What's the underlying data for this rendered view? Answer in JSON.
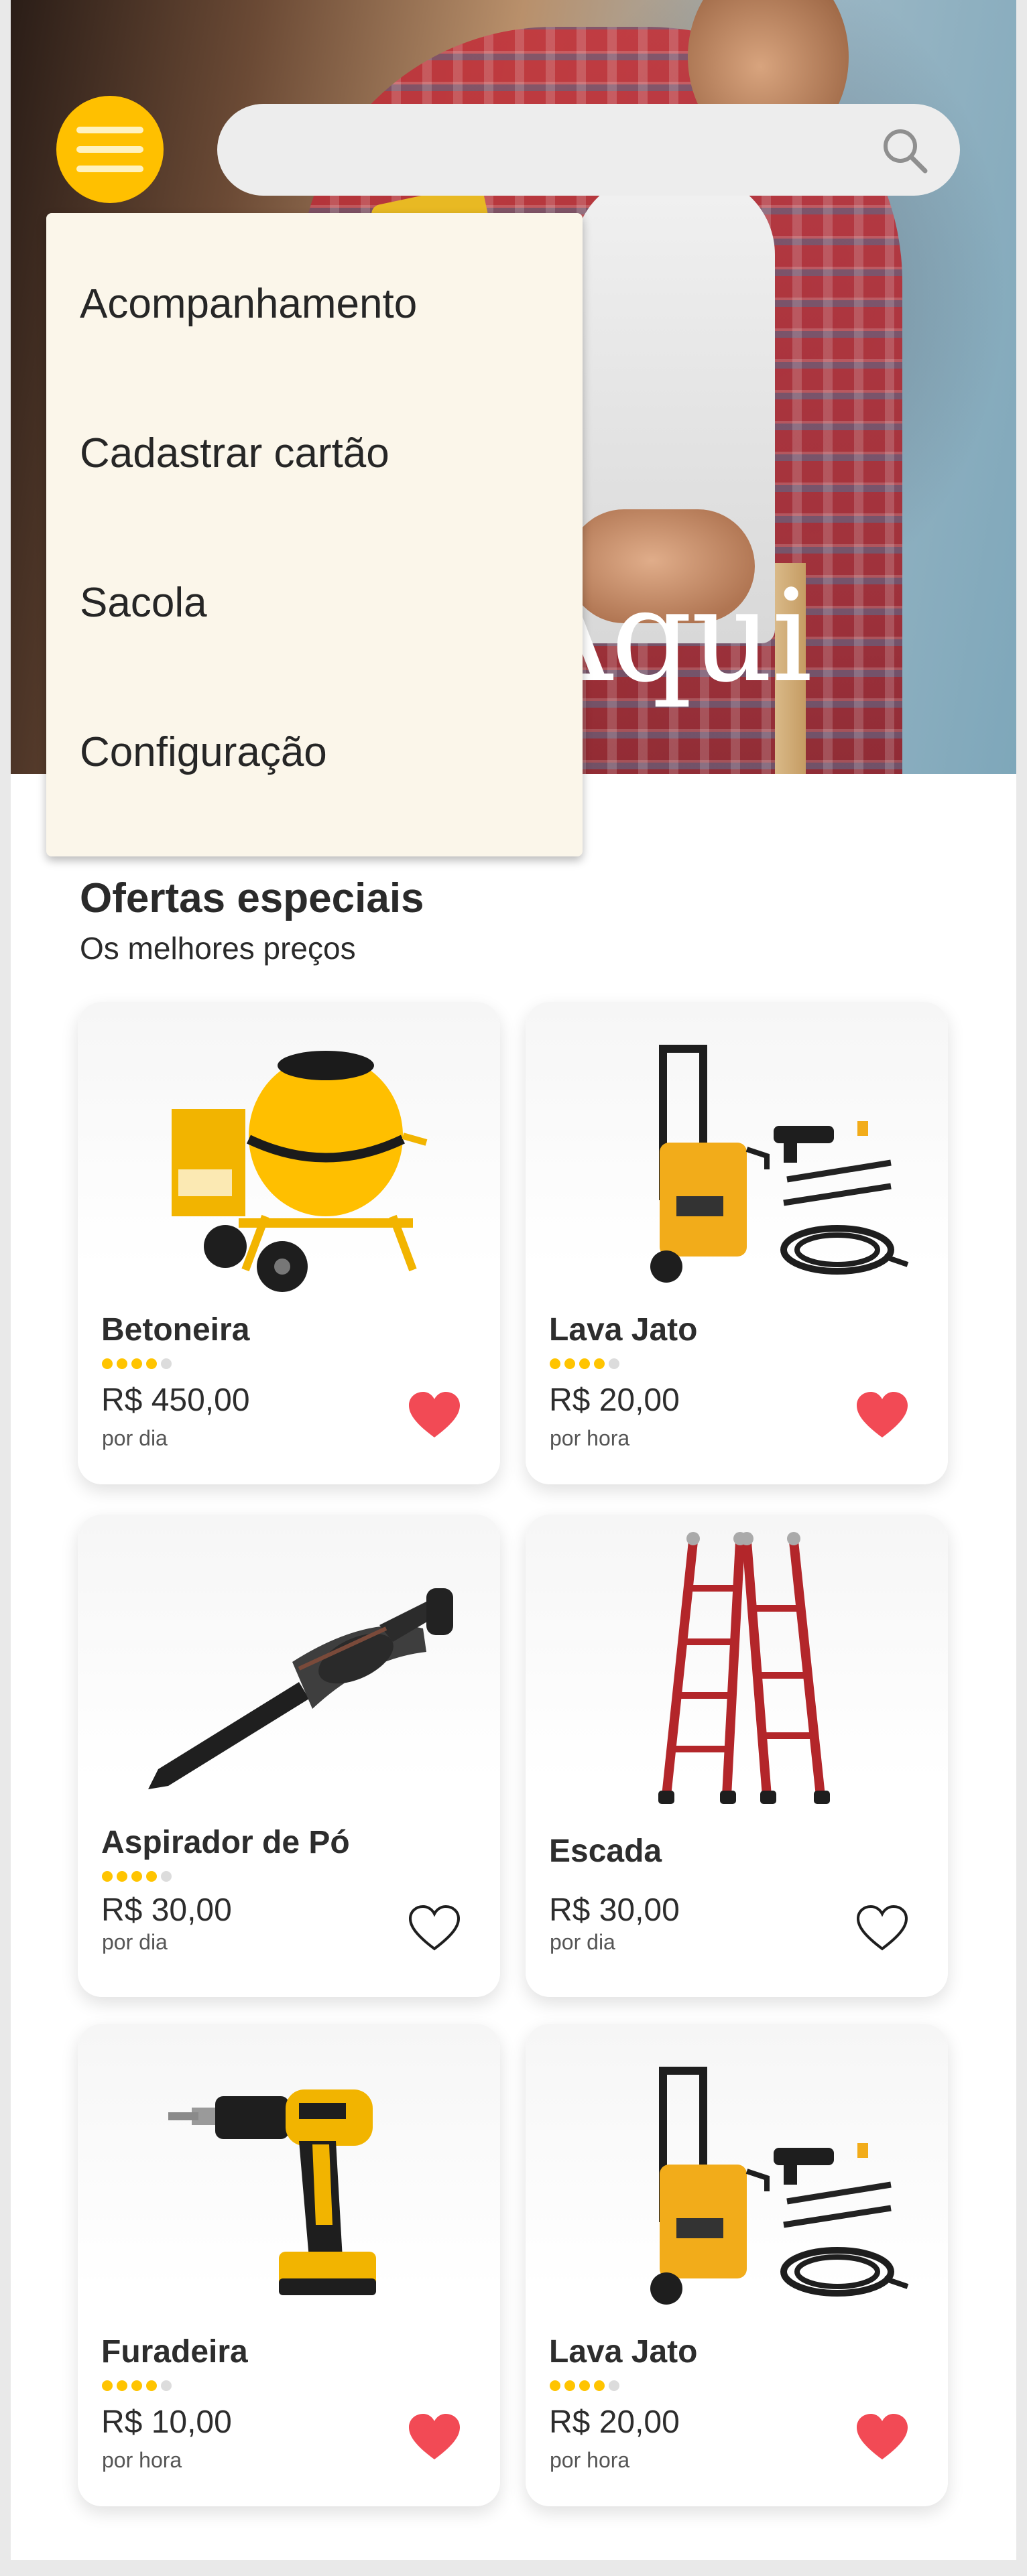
{
  "hero": {
    "tagline": "Aqui"
  },
  "search": {
    "placeholder": "",
    "value": ""
  },
  "menu": {
    "items": [
      {
        "label": "Acompanhamento"
      },
      {
        "label": "Cadastrar cartão"
      },
      {
        "label": "Sacola"
      },
      {
        "label": "Configuração"
      }
    ]
  },
  "section": {
    "title": "Ofertas especiais",
    "subtitle": "Os melhores preços"
  },
  "products": [
    {
      "name": "Betoneira",
      "rating": 4,
      "price": "R$ 450,00",
      "unit": "por dia",
      "favorite": true,
      "image": "concrete-mixer"
    },
    {
      "name": "Lava Jato",
      "rating": 4,
      "price": "R$ 20,00",
      "unit": "por hora",
      "favorite": true,
      "image": "pressure-washer"
    },
    {
      "name": "Aspirador de Pó",
      "rating": 4,
      "price": "R$ 30,00",
      "unit": "por dia",
      "favorite": false,
      "image": "vacuum-cleaner"
    },
    {
      "name": "Escada",
      "rating": null,
      "price": "R$ 30,00",
      "unit": "por dia",
      "favorite": false,
      "image": "ladder"
    },
    {
      "name": "Furadeira",
      "rating": 4,
      "price": "R$ 10,00",
      "unit": "por hora",
      "favorite": true,
      "image": "drill"
    },
    {
      "name": "Lava Jato",
      "rating": 4,
      "price": "R$ 20,00",
      "unit": "por hora",
      "favorite": true,
      "image": "pressure-washer"
    }
  ],
  "colors": {
    "accent": "#ffc000",
    "menu_background": "#fbf6ea",
    "favorite_on": "#f24a55",
    "star_on": "#ffc400",
    "star_off": "#dcdcdc"
  }
}
